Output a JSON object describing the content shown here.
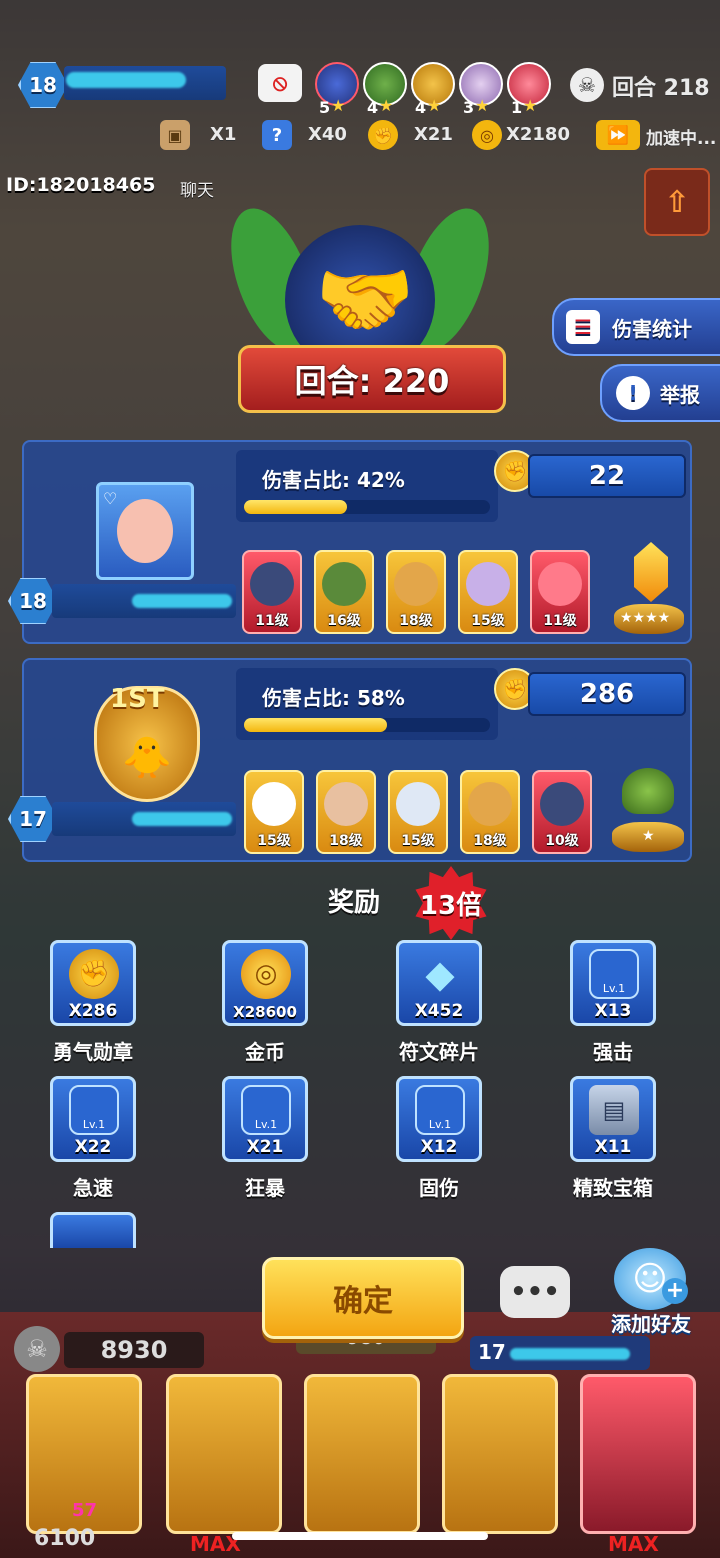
{
  "colors": {
    "accent_gold": "#f3b60e",
    "panel_blue": "#244896",
    "ribbon_red": "#c0282a"
  },
  "hud": {
    "player_level": "18",
    "round_label": "回合 218",
    "hero_stars": [
      "5",
      "4",
      "4",
      "3",
      "1"
    ],
    "items": [
      {
        "icon": "box-icon",
        "count": "X1"
      },
      {
        "icon": "mystery-icon",
        "count": "X40"
      },
      {
        "icon": "medal-icon",
        "count": "X21"
      },
      {
        "icon": "coin-icon",
        "count": "X2180"
      }
    ],
    "speed_label": "加速中...",
    "player_id": "ID:182018465",
    "chat_label": "聊天"
  },
  "result": {
    "round_text": "回合: 220",
    "icon": "handshake-icon"
  },
  "side_buttons": {
    "damage_stats": "伤害统计",
    "report": "举报"
  },
  "players": [
    {
      "level": "18",
      "damage_label": "伤害占比: 42%",
      "damage_pct": 42,
      "score": "22",
      "heroes": [
        {
          "lv": "11级",
          "rarity": "red"
        },
        {
          "lv": "16级",
          "rarity": "gold"
        },
        {
          "lv": "18级",
          "rarity": "gold"
        },
        {
          "lv": "15级",
          "rarity": "gold"
        },
        {
          "lv": "11级",
          "rarity": "red"
        }
      ],
      "gem_stars": 4
    },
    {
      "level": "17",
      "damage_label": "伤害占比: 58%",
      "damage_pct": 58,
      "score": "286",
      "badge": "1ST",
      "heroes": [
        {
          "lv": "15级",
          "rarity": "gold"
        },
        {
          "lv": "18级",
          "rarity": "gold"
        },
        {
          "lv": "15级",
          "rarity": "gold"
        },
        {
          "lv": "18级",
          "rarity": "gold"
        },
        {
          "lv": "10级",
          "rarity": "red"
        }
      ],
      "gem_stars": 1
    }
  ],
  "rewards": {
    "title": "奖励",
    "multiplier": "13倍",
    "items": [
      {
        "qty": "X286",
        "label": "勇气勋章",
        "icon": "medal-icon"
      },
      {
        "qty": "X28600",
        "label": "金币",
        "icon": "coin-icon"
      },
      {
        "qty": "X452",
        "label": "符文碎片",
        "icon": "crystal-icon"
      },
      {
        "qty": "X13",
        "label": "强击",
        "icon": "rune-icon"
      },
      {
        "qty": "X22",
        "label": "急速",
        "icon": "rune-icon"
      },
      {
        "qty": "X21",
        "label": "狂暴",
        "icon": "rune-icon"
      },
      {
        "qty": "X12",
        "label": "固伤",
        "icon": "rune-icon"
      },
      {
        "qty": "X11",
        "label": "精致宝箱",
        "icon": "chest-icon"
      }
    ],
    "lv_tag": "Lv.1"
  },
  "confirm_label": "确定",
  "add_friend_label": "添加好友",
  "bottom": {
    "coins": "8930",
    "other_coins": "980",
    "opponent_level": "17",
    "gold_left": "6100",
    "level_badge": "57",
    "max_label": "MAX"
  }
}
